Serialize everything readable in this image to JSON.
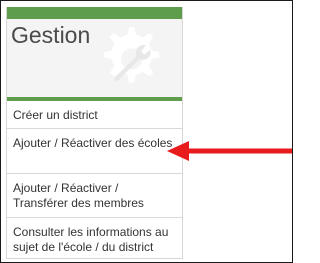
{
  "panel": {
    "title": "Gestion",
    "header_icon": "gear-wrench-icon",
    "accent_color": "#5e9d4c"
  },
  "menu": {
    "items": [
      {
        "label": "Créer un district"
      },
      {
        "label": "Ajouter / Réactiver des écoles"
      },
      {
        "label": "Ajouter / Réactiver / Transférer des membres"
      },
      {
        "label": "Consulter les informations au sujet de l'école / du district"
      }
    ]
  },
  "annotation": {
    "icon": "red-arrow-icon",
    "color": "#e81c1c",
    "points_to": "Ajouter / Réactiver des écoles"
  }
}
